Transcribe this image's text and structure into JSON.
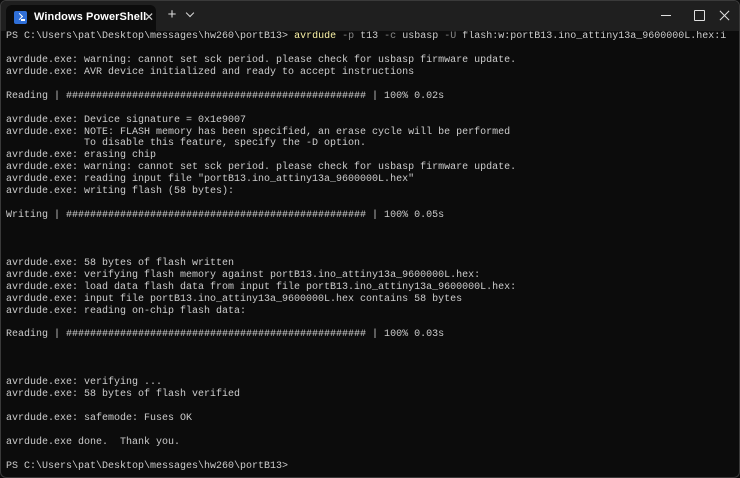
{
  "window": {
    "tab_title": "Windows PowerShell",
    "tab_icon": "powershell-icon",
    "close_tab_icon": "close-icon",
    "new_tab_label": "+",
    "dropdown_icon": "chevron-down-icon",
    "controls": [
      "minimize-icon",
      "maximize-icon",
      "close-icon"
    ]
  },
  "colors": {
    "background": "#0c0c0c",
    "text": "#cccccc",
    "command": "#f9f1a5",
    "parameter": "#8a8a8a",
    "titlebar": "#1f1f1f"
  },
  "terminal": {
    "prompt1": "PS C:\\Users\\pat\\Desktop\\messages\\hw260\\portB13>",
    "command": {
      "exe": "avrdude",
      "p_flag": "-p",
      "p_value": "t13",
      "c_flag": "-c",
      "c_value": "usbasp",
      "u_flag": "-U",
      "u_value": "flash:w:portB13.ino_attiny13a_9600000L.hex:i"
    },
    "lines": [
      "",
      "avrdude.exe: warning: cannot set sck period. please check for usbasp firmware update.",
      "avrdude.exe: AVR device initialized and ready to accept instructions",
      "",
      "Reading | ################################################## | 100% 0.02s",
      "",
      "avrdude.exe: Device signature = 0x1e9007",
      "avrdude.exe: NOTE: FLASH memory has been specified, an erase cycle will be performed",
      "             To disable this feature, specify the -D option.",
      "avrdude.exe: erasing chip",
      "avrdude.exe: warning: cannot set sck period. please check for usbasp firmware update.",
      "avrdude.exe: reading input file \"portB13.ino_attiny13a_9600000L.hex\"",
      "avrdude.exe: writing flash (58 bytes):",
      "",
      "Writing | ################################################## | 100% 0.05s",
      "",
      "",
      "",
      "avrdude.exe: 58 bytes of flash written",
      "avrdude.exe: verifying flash memory against portB13.ino_attiny13a_9600000L.hex:",
      "avrdude.exe: load data flash data from input file portB13.ino_attiny13a_9600000L.hex:",
      "avrdude.exe: input file portB13.ino_attiny13a_9600000L.hex contains 58 bytes",
      "avrdude.exe: reading on-chip flash data:",
      "",
      "Reading | ################################################## | 100% 0.03s",
      "",
      "",
      "",
      "avrdude.exe: verifying ...",
      "avrdude.exe: 58 bytes of flash verified",
      "",
      "avrdude.exe: safemode: Fuses OK",
      "",
      "avrdude.exe done.  Thank you.",
      "",
      "PS C:\\Users\\pat\\Desktop\\messages\\hw260\\portB13>"
    ]
  }
}
